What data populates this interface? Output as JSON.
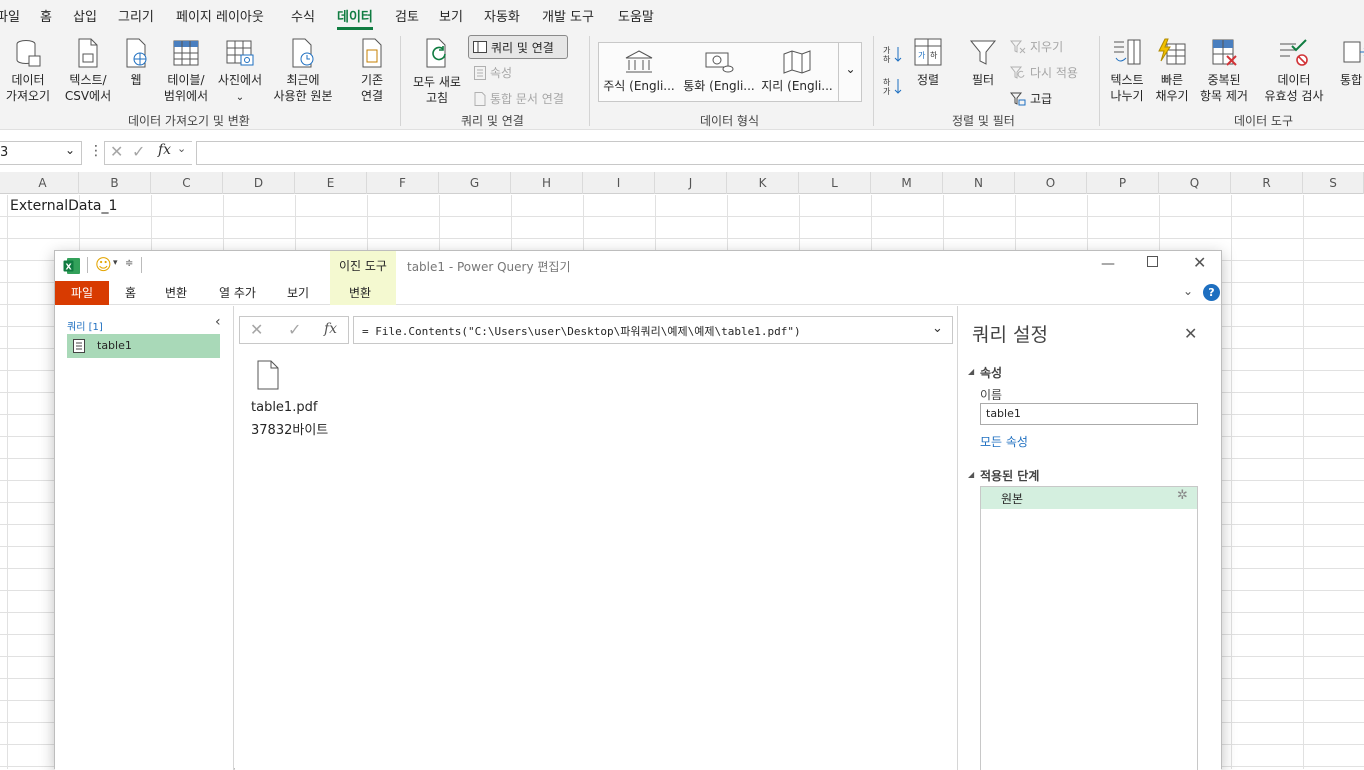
{
  "menu": {
    "tabs": [
      "파일",
      "홈",
      "삽입",
      "그리기",
      "페이지 레이아웃",
      "수식",
      "데이터",
      "검토",
      "보기",
      "자동화",
      "개발 도구",
      "도움말"
    ],
    "active": "데이터"
  },
  "ribbon": {
    "get_data": "데이터\n가져오기",
    "text_csv": "텍스트/\nCSV에서",
    "web": "웹",
    "table_range": "테이블/\n범위에서",
    "from_picture": "사진에서",
    "recent_sources": "최근에\n사용한 원본",
    "existing_conn": "기존\n연결",
    "group_get_transform": "데이터 가져오기 및 변환",
    "refresh_all": "모두 새로\n고침",
    "queries_conn": "쿼리 및 연결",
    "properties": "속성",
    "edit_links": "통합 문서 연결",
    "group_queries": "쿼리 및 연결",
    "stocks": "주식 (Engli...",
    "currency": "통화 (Engli...",
    "geography": "지리 (Engli...",
    "group_data_types": "데이터 형식",
    "sort": "정렬",
    "filter": "필터",
    "clear": "지우기",
    "reapply": "다시 적용",
    "advanced": "고급",
    "group_sort_filter": "정렬 및 필터",
    "text_to_columns": "텍스트\n나누기",
    "flash_fill": "빠른\n채우기",
    "remove_duplicates": "중복된\n항목 제거",
    "data_validation": "데이터\n유효성 검사",
    "consolidate": "통합",
    "group_data_tools": "데이터 도구"
  },
  "formula_bar": {
    "name_box": "3",
    "fx": "fx"
  },
  "sheet": {
    "columns": [
      "A",
      "B",
      "C",
      "D",
      "E",
      "F",
      "G",
      "H",
      "I",
      "J",
      "K",
      "L",
      "M",
      "N",
      "O",
      "P",
      "Q",
      "R",
      "S"
    ],
    "a1": "ExternalData_1"
  },
  "pq": {
    "context_tab": "이진 도구",
    "title": "table1 - Power Query 편집기",
    "tabs": {
      "file": "파일",
      "home": "홈",
      "transform": "변환",
      "add_column": "열 추가",
      "view": "보기",
      "context_transform": "변환"
    },
    "queries_header": "쿼리 [1]",
    "query_name": "table1",
    "formula": "= File.Contents(\"C:\\Users\\user\\Desktop\\파워쿼리\\예제\\예제\\table1.pdf\")",
    "file_name": "table1.pdf",
    "file_size": "37832바이트",
    "settings_title": "쿼리 설정",
    "properties_header": "속성",
    "name_label": "이름",
    "name_value": "table1",
    "all_properties": "모든 속성",
    "applied_steps_header": "적용된 단계",
    "step_source": "원본"
  },
  "colors": {
    "accent": "#107c41",
    "pq_file": "#d83b01",
    "selected": "#a9d9b8",
    "step_bg": "#d4efdf",
    "context_tab": "#f4f9d0"
  }
}
